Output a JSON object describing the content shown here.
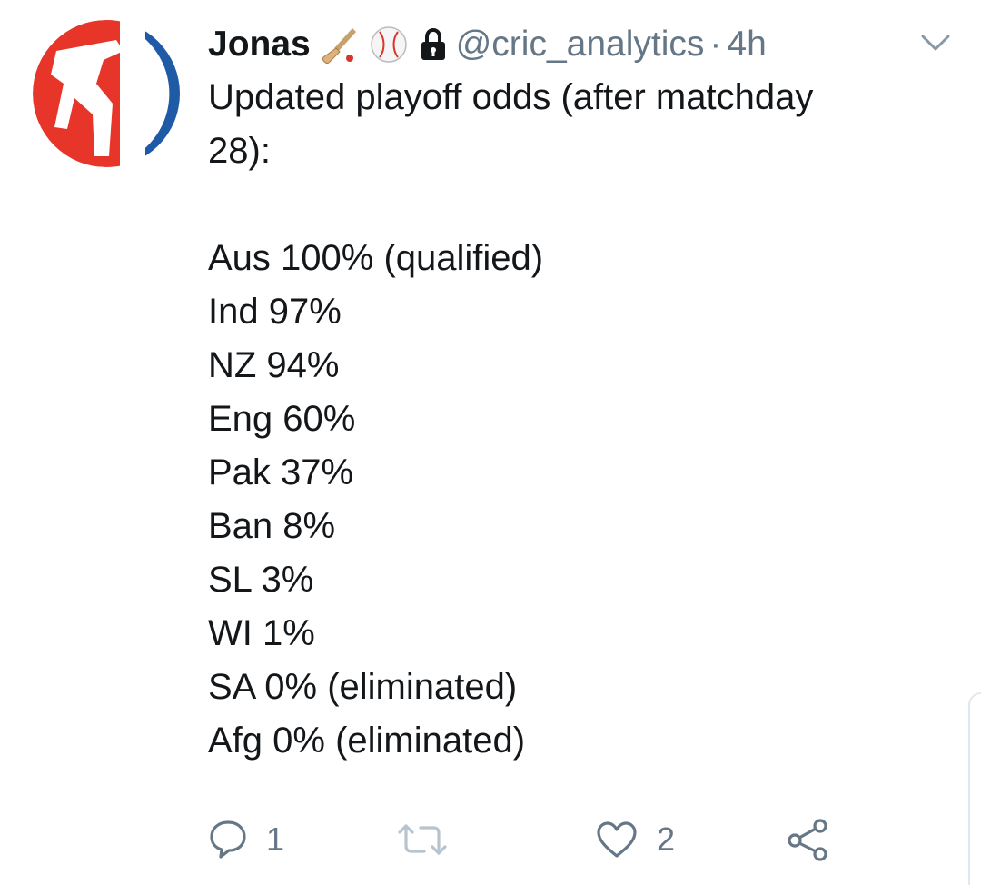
{
  "tweet": {
    "author": {
      "name": "Jonas",
      "handle": "@cric_analytics",
      "emojis": [
        "cricket-bat-icon",
        "baseball-icon",
        "lock-icon"
      ]
    },
    "separator": "·",
    "time": "4h",
    "text_lines": [
      "Updated playoff odds (after matchday",
      "28):"
    ],
    "odds": [
      "Aus 100% (qualified)",
      "Ind 97%",
      "NZ 94%",
      "Eng 60%",
      "Pak 37%",
      "Ban 8%",
      "SL 3%",
      "WI 1%",
      "SA 0% (eliminated)",
      "Afg 0% (eliminated)"
    ],
    "actions": {
      "reply_count": "1",
      "retweet_count": "",
      "like_count": "2"
    }
  },
  "colors": {
    "text": "#14171a",
    "secondary": "#657786",
    "avatar_red": "#e8352a",
    "avatar_blue": "#1f5aa6"
  }
}
